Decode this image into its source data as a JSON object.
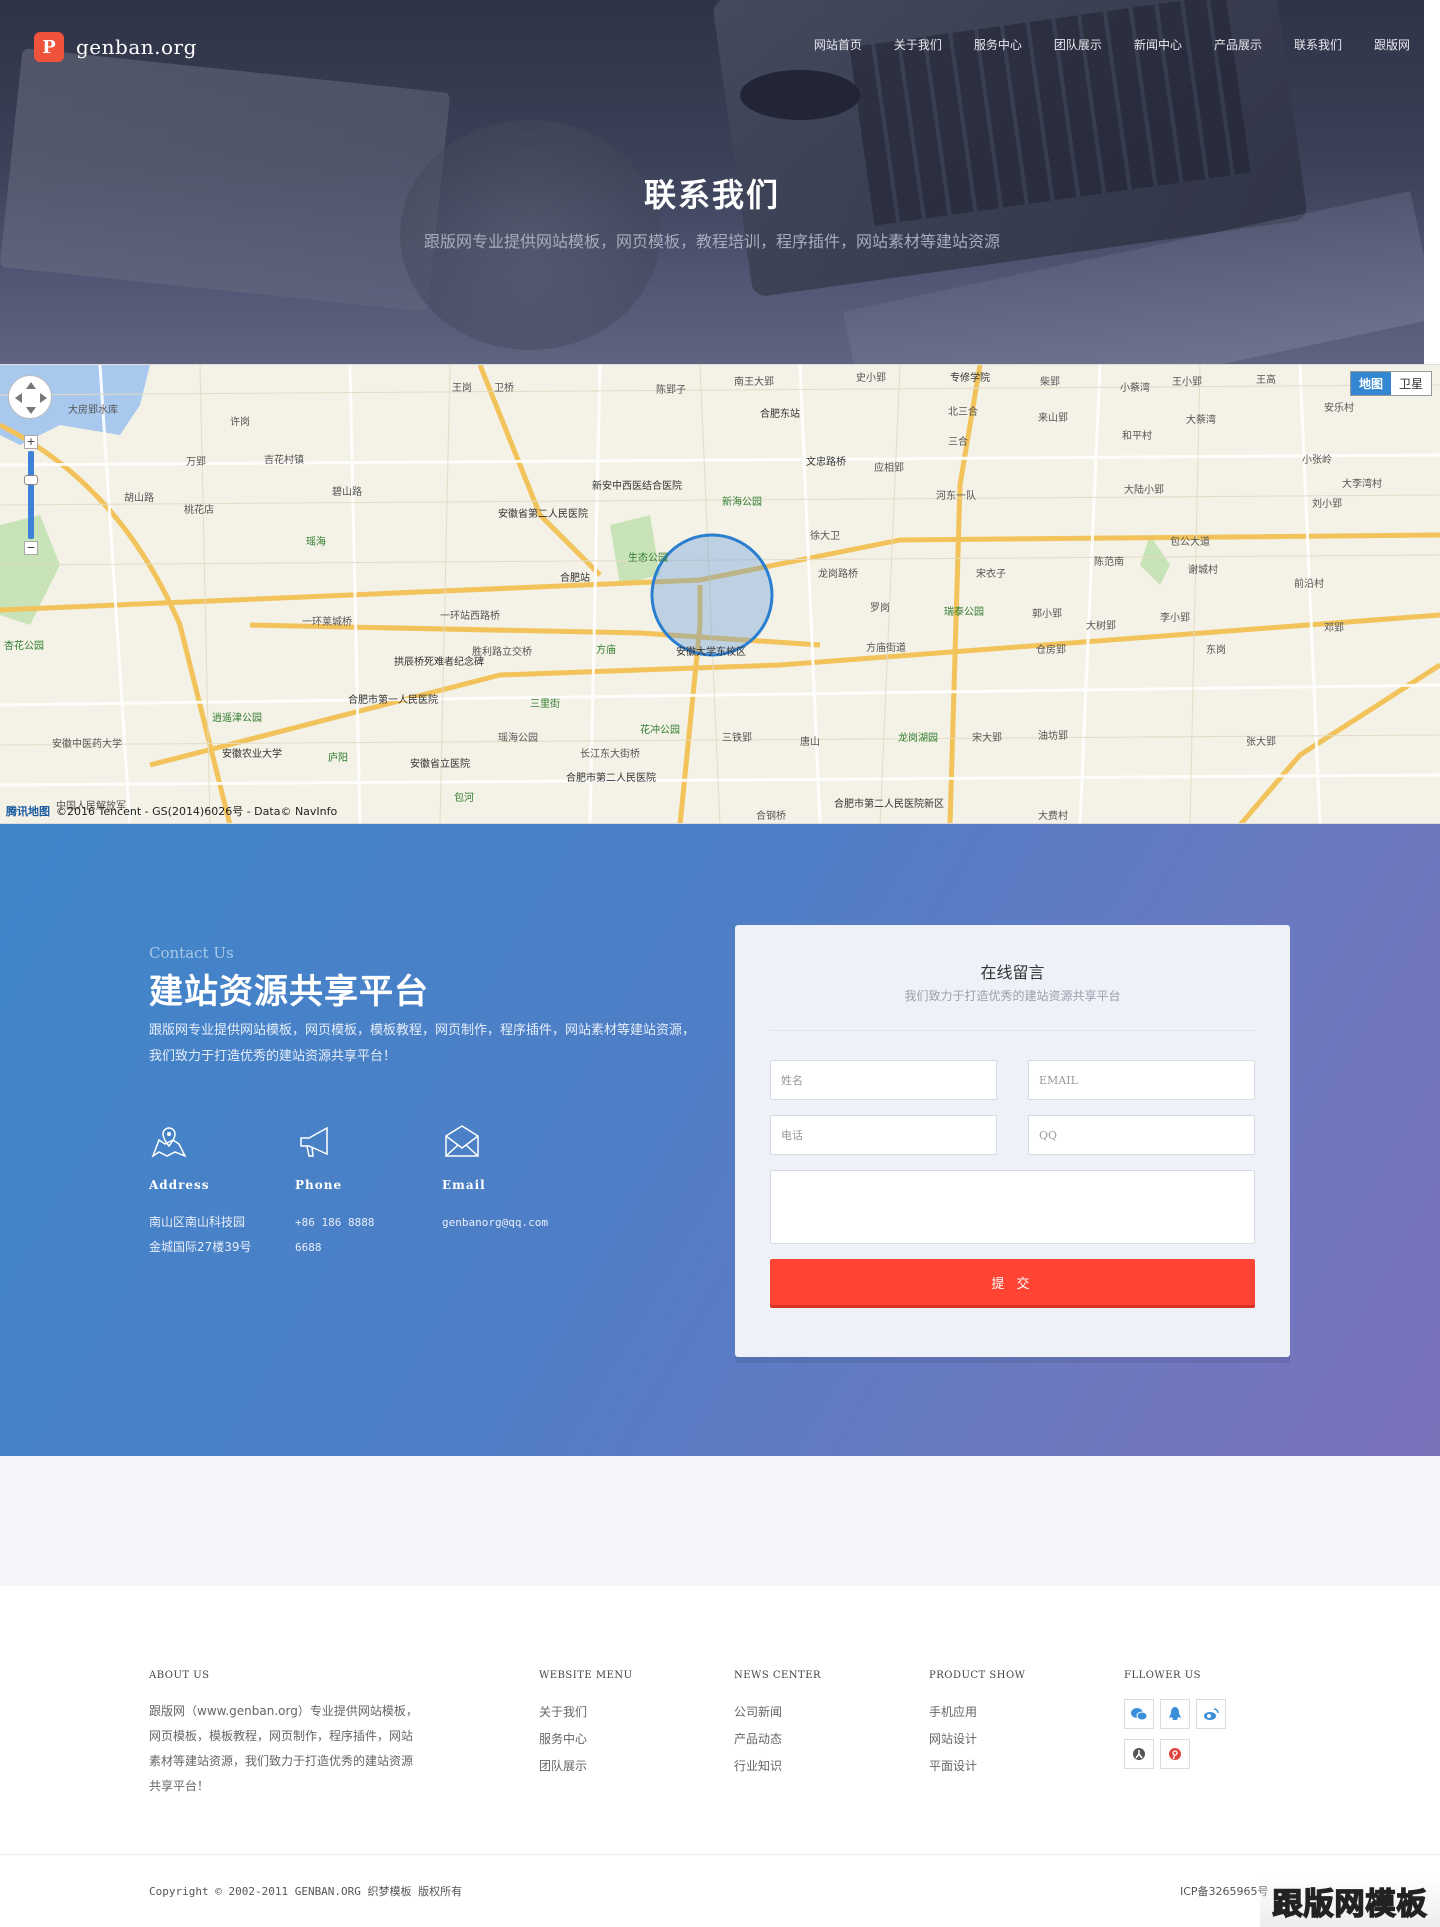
{
  "header": {
    "logo_glyph": "P",
    "logo_text": "genban.org",
    "nav": [
      "网站首页",
      "关于我们",
      "服务中心",
      "团队展示",
      "新闻中心",
      "产品展示",
      "联系我们",
      "跟版网"
    ],
    "title": "联系我们",
    "subtitle": "跟版网专业提供网站模板，网页模板，教程培训，程序插件，网站素材等建站资源"
  },
  "map": {
    "switch": [
      "地图",
      "卫星"
    ],
    "zoom_in": "+",
    "zoom_out": "−",
    "brand": "腾讯地图",
    "credit": "©2016 Tencent - GS(2014)6026号 - Data© NavInfo",
    "labels": [
      "大房郢水库",
      "许岗",
      "王岗",
      "卫桥",
      "陈郢子",
      "南王大郢",
      "史小郢",
      "专修学院",
      "柴郢",
      "王小郢",
      "王高",
      "安乐村",
      "合肥东站",
      "北三合",
      "来山郢",
      "小蔡湾",
      "大蔡湾",
      "和平村",
      "三合",
      "吉花村镇",
      "万郢",
      "胡山路",
      "碧山路",
      "桃花店",
      "杏花公园",
      "安徽省第二人民医院",
      "新安中西医结合医院",
      "新海公园",
      "文忠路桥",
      "应相郢",
      "河东一队",
      "大陆小郢",
      "小张岭",
      "大李湾村",
      "刘小郢",
      "徐大卫",
      "包公大道",
      "陈范南",
      "谢城村",
      "前沿村",
      "合肥站",
      "生态公园",
      "龙岗路桥",
      "宋衣子",
      "郭小郢",
      "李小郢",
      "邓郢",
      "一环莱城桥",
      "一环站西路桥",
      "胜利路立交桥",
      "方庙",
      "合肥市第一人民医院",
      "拱辰桥死难者纪念碑",
      "安徽大学东校区",
      "罗岗",
      "瑞泰公园",
      "方庙街道",
      "大树郢",
      "仓房郢",
      "东岗",
      "三里街",
      "瑶海公园",
      "长江东大街桥",
      "花冲公园",
      "三铁郢",
      "唐山",
      "龙岗湖园",
      "宋大郢",
      "油坊郢",
      "张大郢",
      "安徽省立医院",
      "安徽农业大学",
      "逍遥津公园",
      "合肥市第二人民医院",
      "合肥市第二人民医院新区",
      "庐阳",
      "瑶海",
      "包河",
      "安徽中医药大学",
      "中国人民解放军",
      "合钢桥",
      "大费村"
    ]
  },
  "contact": {
    "kicker": "Contact Us",
    "title": "建站资源共享平台",
    "desc": "跟版网专业提供网站模板，网页模板，模板教程，网页制作，程序插件，网站素材等建站资源，我们致力于打造优秀的建站资源共享平台！",
    "items": [
      {
        "icon": "map-pin-icon",
        "label": "Address",
        "lines": [
          "南山区南山科技园",
          "金城国际27楼39号"
        ]
      },
      {
        "icon": "megaphone-icon",
        "label": "Phone",
        "lines": [
          "+86 186 8888",
          "6688"
        ]
      },
      {
        "icon": "envelope-icon",
        "label": "Email",
        "lines": [
          "genbanorg@qq.com"
        ]
      }
    ],
    "form": {
      "title": "在线留言",
      "subtitle": "我们致力于打造优秀的建站资源共享平台",
      "name_placeholder": "姓名",
      "email_placeholder": "EMAIL",
      "phone_placeholder": "电话",
      "qq_placeholder": "QQ",
      "message_placeholder": "",
      "submit": "提 交"
    }
  },
  "footer": {
    "about": {
      "heading": "ABOUT US",
      "text": "跟版网（www.genban.org）专业提供网站模板，网页模板，模板教程，网页制作，程序插件，网站素材等建站资源，我们致力于打造优秀的建站资源共享平台！"
    },
    "website_menu": {
      "heading": "WEBSITE MENU",
      "links": [
        "关于我们",
        "服务中心",
        "团队展示"
      ]
    },
    "news_center": {
      "heading": "NEWS CENTER",
      "links": [
        "公司新闻",
        "产品动态",
        "行业知识"
      ]
    },
    "product_show": {
      "heading": "PRODUCT SHOW",
      "links": [
        "手机应用",
        "网站设计",
        "平面设计"
      ]
    },
    "follow": {
      "heading": "FLLOWER US",
      "icons": [
        "wechat-icon",
        "qq-icon",
        "weibo-icon",
        "renren-icon",
        "pinterest-icon"
      ]
    },
    "copyright": "Copyright © 2002-2011 GENBAN.ORG 织梦模板 版权所有",
    "icp": "ICP备3265965号",
    "watermark": "跟版网模板"
  },
  "colors": {
    "brand": "#f0533b",
    "submit": "#ff4433",
    "map_blue": "#3387d1"
  }
}
